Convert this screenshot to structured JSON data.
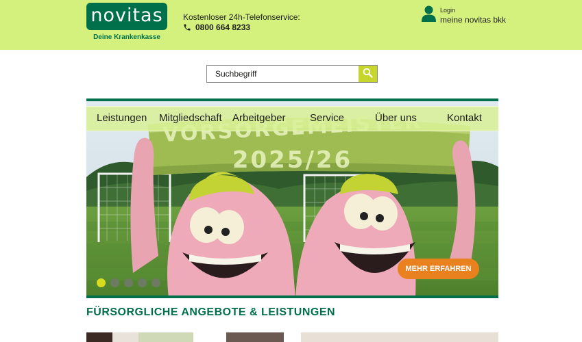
{
  "header": {
    "logo_text": "novitas",
    "logo_tagline": "Deine Krankenkasse",
    "hotline_label": "Kostenloser 24h-Telefonservice:",
    "hotline_number": "0800 664 8233",
    "login_label": "Login",
    "login_link": "meine novitas bkk",
    "icons": [
      "phone-icon",
      "user-icon"
    ]
  },
  "search": {
    "placeholder": "Suchbegriff",
    "icon": "search-icon"
  },
  "nav": {
    "items": [
      "Leistungen",
      "Mitgliedschaft",
      "Arbeitgeber",
      "Service",
      "Über uns",
      "Kontakt"
    ]
  },
  "hero": {
    "banner_line1": "VORSORGEMEISTER",
    "banner_line2": "2025/26",
    "cta_label": "MEHR ERFAHREN",
    "slides_total": 5,
    "active_slide": 1
  },
  "section": {
    "title": "FÜRSORGLICHE ANGEBOTE & LEISTUNGEN"
  },
  "colors": {
    "topbar": "#d4f17e",
    "brand_green": "#00704a",
    "accent_orange": "#e9821e",
    "search_button": "#c7d62a",
    "dot_active": "#d8dc1f"
  }
}
